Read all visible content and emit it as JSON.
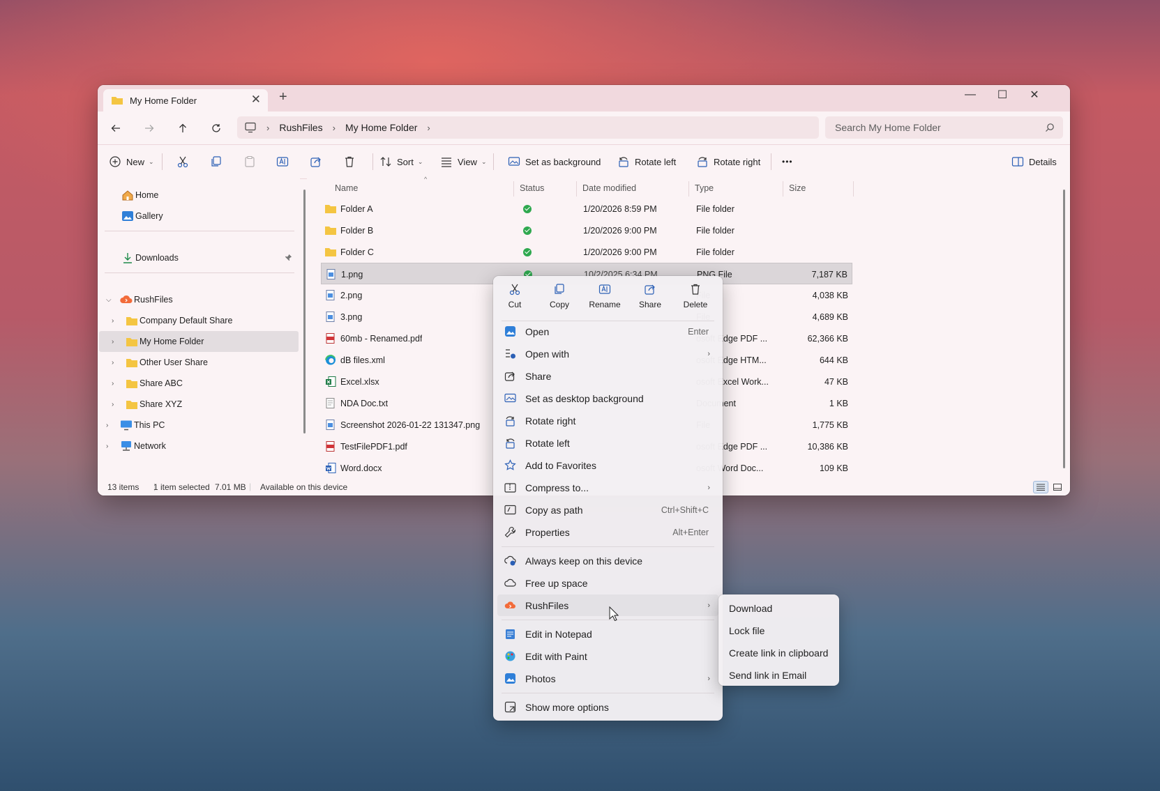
{
  "window": {
    "tab_title": "My Home Folder",
    "new_tab": "+",
    "close_tab": "✕",
    "minimize": "—",
    "maximize": "☐",
    "close": "✕"
  },
  "nav": {
    "breadcrumb": [
      "RushFiles",
      "My Home Folder"
    ],
    "search_placeholder": "Search My Home Folder"
  },
  "toolbar": {
    "new_label": "New",
    "sort_label": "Sort",
    "view_label": "View",
    "set_bg_label": "Set as background",
    "rotate_left_label": "Rotate left",
    "rotate_right_label": "Rotate right",
    "more_label": "•••",
    "details_label": "Details"
  },
  "sidebar": {
    "items": [
      {
        "label": "Home"
      },
      {
        "label": "Gallery"
      },
      {
        "label": "Downloads"
      },
      {
        "label": "RushFiles"
      },
      {
        "label": "Company Default Share"
      },
      {
        "label": "My Home Folder"
      },
      {
        "label": "Other User Share"
      },
      {
        "label": "Share ABC"
      },
      {
        "label": "Share XYZ"
      },
      {
        "label": "This PC"
      },
      {
        "label": "Network"
      }
    ]
  },
  "columns": {
    "name": "Name",
    "status": "Status",
    "date": "Date modified",
    "type": "Type",
    "size": "Size"
  },
  "files": [
    {
      "name": "Folder A",
      "date": "1/20/2026 8:59 PM",
      "type": "File folder",
      "size": ""
    },
    {
      "name": "Folder B",
      "date": "1/20/2026 9:00 PM",
      "type": "File folder",
      "size": ""
    },
    {
      "name": "Folder C",
      "date": "1/20/2026 9:00 PM",
      "type": "File folder",
      "size": ""
    },
    {
      "name": "1.png",
      "date": "10/2/2025 6:34 PM",
      "type": "PNG File",
      "size": "7,187 KB"
    },
    {
      "name": "2.png",
      "date": "",
      "type": "File",
      "size": "4,038 KB"
    },
    {
      "name": "3.png",
      "date": "",
      "type": "File",
      "size": "4,689 KB"
    },
    {
      "name": "60mb - Renamed.pdf",
      "date": "",
      "type": "osoft Edge PDF ...",
      "size": "62,366 KB"
    },
    {
      "name": "dB files.xml",
      "date": "",
      "type": "osoft Edge HTM...",
      "size": "644 KB"
    },
    {
      "name": "Excel.xlsx",
      "date": "",
      "type": "osoft Excel Work...",
      "size": "47 KB"
    },
    {
      "name": "NDA Doc.txt",
      "date": "",
      "type": "Document",
      "size": "1 KB"
    },
    {
      "name": "Screenshot 2026-01-22 131347.png",
      "date": "",
      "type": "File",
      "size": "1,775 KB"
    },
    {
      "name": "TestFilePDF1.pdf",
      "date": "",
      "type": "osoft Edge PDF ...",
      "size": "10,386 KB"
    },
    {
      "name": "Word.docx",
      "date": "",
      "type": "osoft Word Doc...",
      "size": "109 KB"
    }
  ],
  "statusbar": {
    "items_count": "13 items",
    "selected": "1 item selected",
    "selected_size": "7.01 MB",
    "availability": "Available on this device"
  },
  "context_menu": {
    "quick_actions": [
      {
        "label": "Cut",
        "icon": "scissors-icon"
      },
      {
        "label": "Copy",
        "icon": "copy-icon"
      },
      {
        "label": "Rename",
        "icon": "rename-icon"
      },
      {
        "label": "Share",
        "icon": "share-icon"
      },
      {
        "label": "Delete",
        "icon": "trash-icon"
      }
    ],
    "items": [
      {
        "label": "Open",
        "shortcut": "Enter"
      },
      {
        "label": "Open with",
        "submenu": true
      },
      {
        "label": "Share"
      },
      {
        "label": "Set as desktop background"
      },
      {
        "label": "Rotate right"
      },
      {
        "label": "Rotate left"
      },
      {
        "label": "Add to Favorites"
      },
      {
        "label": "Compress to...",
        "submenu": true
      },
      {
        "label": "Copy as path",
        "shortcut": "Ctrl+Shift+C"
      },
      {
        "label": "Properties",
        "shortcut": "Alt+Enter"
      },
      {
        "label": "Always keep on this device"
      },
      {
        "label": "Free up space"
      },
      {
        "label": "RushFiles",
        "submenu": true
      },
      {
        "label": "Edit in Notepad"
      },
      {
        "label": "Edit with Paint"
      },
      {
        "label": "Photos",
        "submenu": true
      },
      {
        "label": "Show more options"
      }
    ]
  },
  "rushfiles_submenu": {
    "items": [
      {
        "label": "Download"
      },
      {
        "label": "Lock file"
      },
      {
        "label": "Create link in clipboard"
      },
      {
        "label": "Send link in Email"
      }
    ]
  },
  "colors": {
    "accent": "#0067c0",
    "status_green": "#2fa84f",
    "folder": "#f4c542",
    "rushfiles": "#f26b3a"
  }
}
